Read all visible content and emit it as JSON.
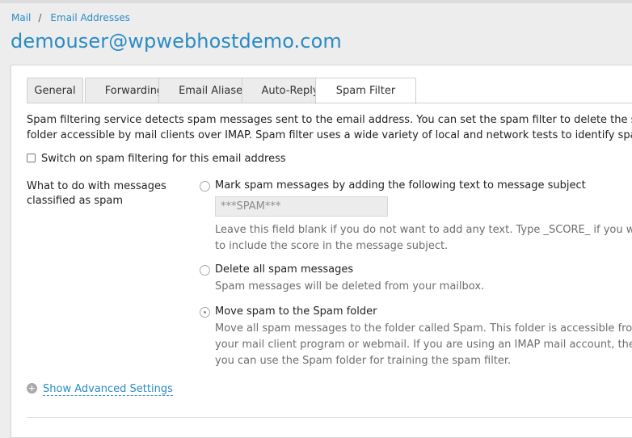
{
  "breadcrumb": {
    "item1": "Mail",
    "separator": "/",
    "item2": "Email Addresses"
  },
  "page_title": "demouser@wpwebhostdemo.com",
  "tabs": [
    {
      "label": "General"
    },
    {
      "label": "Forwarding"
    },
    {
      "label": "Email Aliases"
    },
    {
      "label": "Auto-Reply"
    },
    {
      "label": "Spam Filter",
      "active": true
    }
  ],
  "description": {
    "line1": "Spam filtering service detects spam messages sent to the email address. You can set the spam filter to delete the spam messages",
    "line2": "folder accessible by mail clients over IMAP. Spam filter uses a wide variety of local and network tests to identify spam signatures."
  },
  "switch_checkbox": {
    "label": "Switch on spam filtering for this email address",
    "checked": false
  },
  "action_field": {
    "label": "What to do with messages classified as spam",
    "options": [
      {
        "label": "Mark spam messages by adding the following text to message subject",
        "checked": false,
        "input_value": "***SPAM***",
        "hint_line1": "Leave this field blank if you do not want to add any text. Type _SCORE_ if you want",
        "hint_line2": "to include the score in the message subject."
      },
      {
        "label": "Delete all spam messages",
        "checked": false,
        "hint_line1": "Spam messages will be deleted from your mailbox."
      },
      {
        "label": "Move spam to the Spam folder",
        "checked": true,
        "hint_line1": "Move all spam messages to the folder called Spam. This folder is accessible from",
        "hint_line2": "your mail client program or webmail. If you are using an IMAP mail account, then",
        "hint_line3": "you can use the Spam folder for training the spam filter."
      }
    ]
  },
  "advanced": {
    "label": "Show Advanced Settings",
    "icon": "plus-circle-icon"
  },
  "colors": {
    "accent": "#2a8bc4",
    "hint_text": "#6e6e6e",
    "tab_inactive_bg": "#ececec"
  }
}
